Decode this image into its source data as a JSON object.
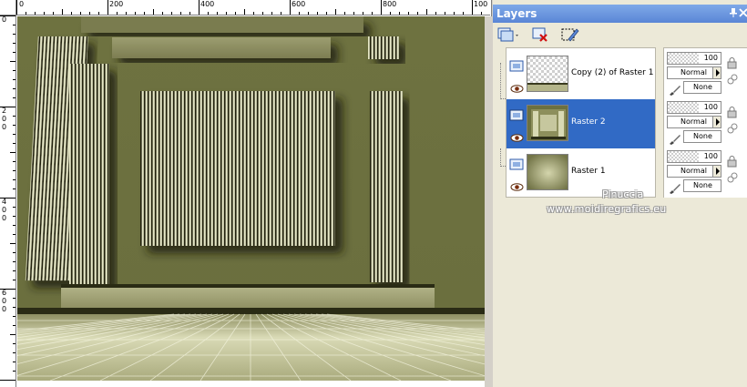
{
  "canvas": {
    "ruler_top_labels": [
      "0",
      "200",
      "400",
      "600",
      "800",
      "100"
    ],
    "ruler_left_labels": [
      "0",
      "200",
      "400",
      "600"
    ]
  },
  "layers_panel": {
    "title": "Layers",
    "pin_icon": "pin-icon",
    "close_icon": "close-icon",
    "toolbar": {
      "new_layer_icon": "new-layer-icon",
      "delete_layer_icon": "delete-layer-icon",
      "edit_selection_icon": "edit-selection-icon"
    },
    "layers": [
      {
        "name": "Copy (2) of Raster 1",
        "opacity": "100",
        "blend_mode": "Normal",
        "group": "None",
        "selected": false
      },
      {
        "name": "Raster 2",
        "opacity": "100",
        "blend_mode": "Normal",
        "group": "None",
        "selected": true
      },
      {
        "name": "Raster 1",
        "opacity": "100",
        "blend_mode": "Normal",
        "group": "None",
        "selected": false
      }
    ]
  },
  "watermark": {
    "line1": "Pinuccia",
    "line2": "www.moidiregrafics.eu"
  },
  "colors": {
    "accent_selection": "#316ac5",
    "canvas_background": "#6f7344",
    "stripe_light": "#e8e9c8",
    "stripe_dark": "#1e1f10"
  }
}
